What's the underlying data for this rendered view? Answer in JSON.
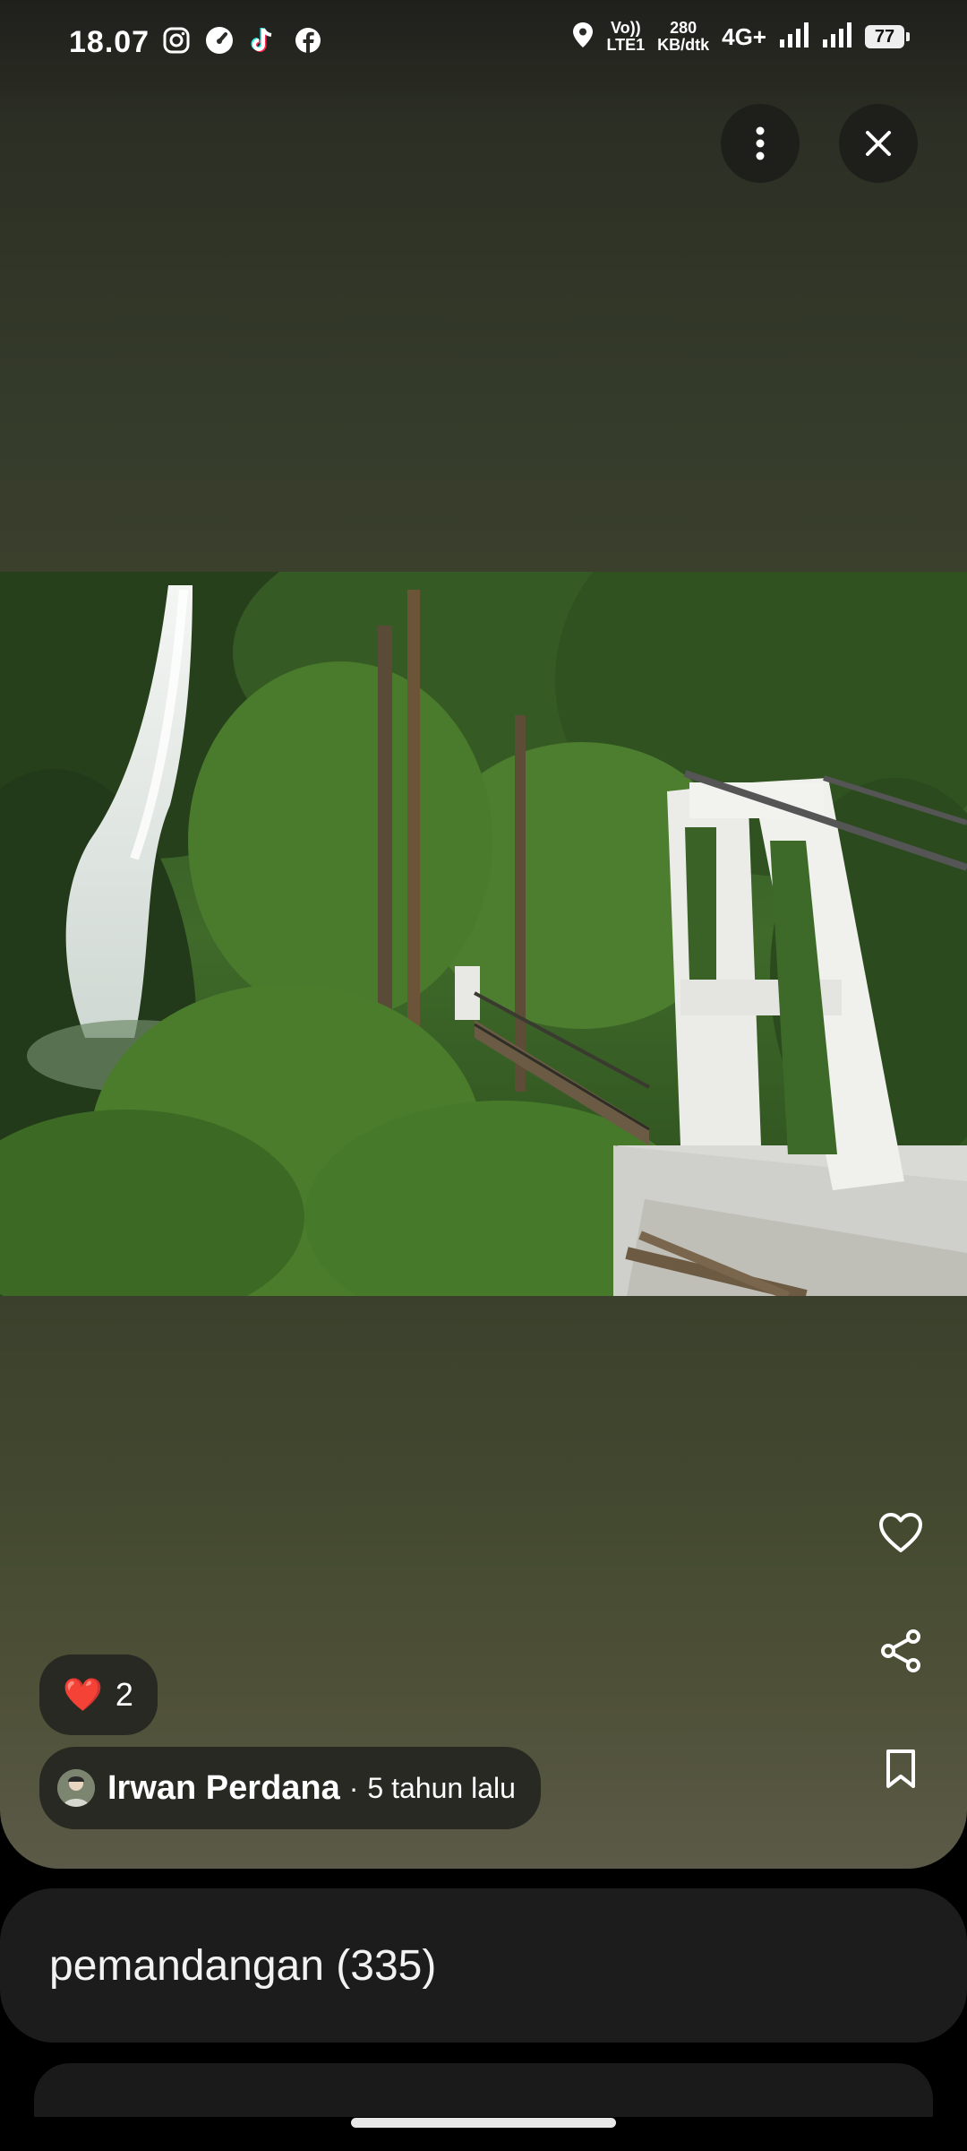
{
  "status_bar": {
    "time": "18.07",
    "volte_label_top": "Vo))",
    "volte_label_bottom": "LTE1",
    "speed_value": "280",
    "speed_unit": "KB/dtk",
    "network": "4G+",
    "battery": "77",
    "app_icons": [
      "instagram-icon",
      "speedometer-icon",
      "tiktok-icon",
      "facebook-icon"
    ]
  },
  "top_actions": {
    "more_icon": "more-vert-icon",
    "close_icon": "close-icon"
  },
  "side_actions": [
    "heart-outline-icon",
    "share-icon",
    "bookmark-icon"
  ],
  "reactions": {
    "emoji": "❤️",
    "count": "2"
  },
  "author": {
    "name": "Irwan Perdana",
    "separator": "·",
    "age": "5 tahun lalu"
  },
  "album": {
    "label": "pemandangan (335)"
  },
  "colors": {
    "viewer_bg": "#3a402c",
    "pill_bg": "#272922",
    "card_bg": "#1c1c1c"
  }
}
